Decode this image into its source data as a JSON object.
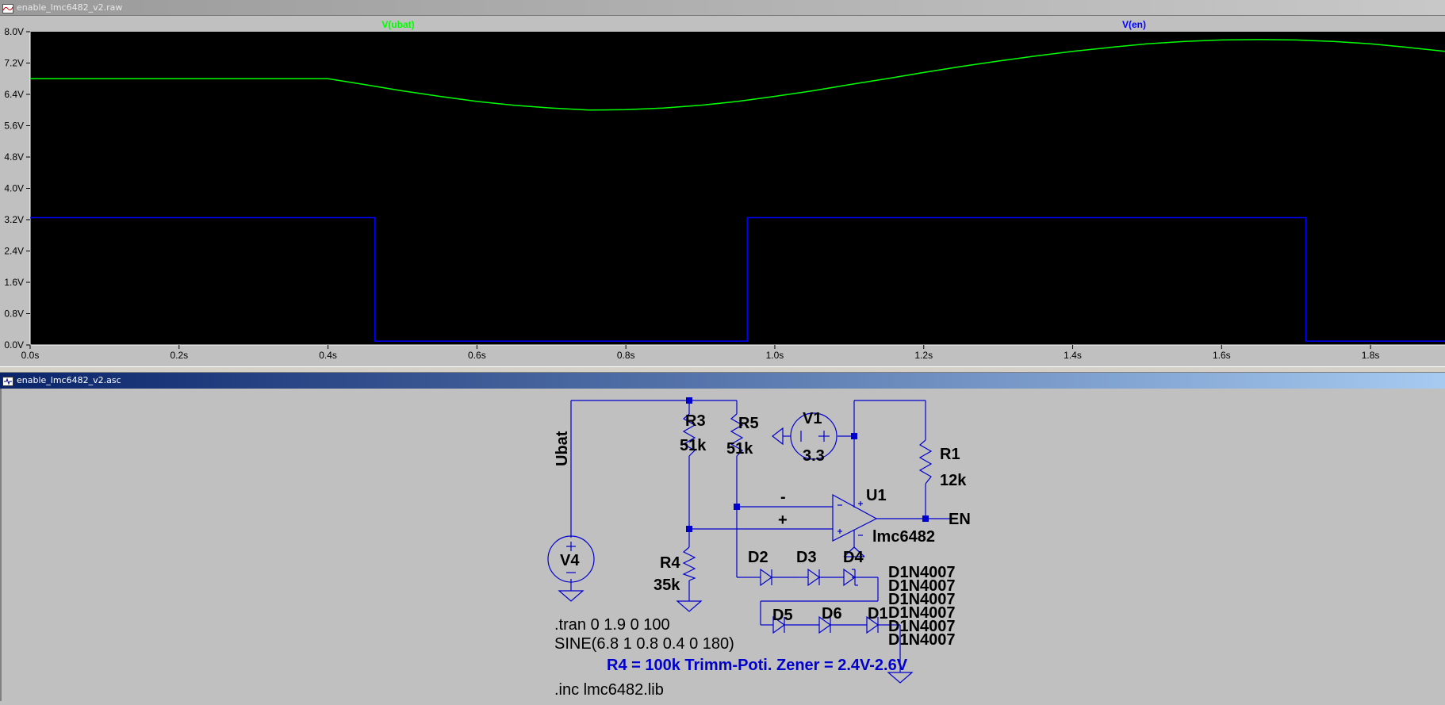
{
  "waveform_window": {
    "title": "enable_lmc6482_v2.raw",
    "traces": [
      {
        "name": "V(ubat)",
        "color": "#00ff00"
      },
      {
        "name": "V(en)",
        "color": "#0000ff"
      }
    ]
  },
  "schematic_window": {
    "title": "enable_lmc6482_v2.asc"
  },
  "chart_data": {
    "type": "line",
    "xlim": [
      0,
      1.9
    ],
    "ylim": [
      0,
      8
    ],
    "x_ticks": [
      "0.0s",
      "0.2s",
      "0.4s",
      "0.6s",
      "0.8s",
      "1.0s",
      "1.2s",
      "1.4s",
      "1.6s",
      "1.8s"
    ],
    "y_ticks": [
      "0.0V",
      "0.8V",
      "1.6V",
      "2.4V",
      "3.2V",
      "4.0V",
      "4.8V",
      "5.6V",
      "6.4V",
      "7.2V",
      "8.0V"
    ],
    "background": "#000000",
    "grid": false,
    "series": [
      {
        "name": "V(ubat)",
        "color": "#00ff00",
        "x": [
          0,
          0.1,
          0.2,
          0.3,
          0.4,
          0.45,
          0.5,
          0.55,
          0.6,
          0.65,
          0.7,
          0.75,
          0.8,
          0.85,
          0.9,
          0.95,
          1.0,
          1.05,
          1.1,
          1.15,
          1.2,
          1.25,
          1.3,
          1.35,
          1.4,
          1.45,
          1.5,
          1.55,
          1.6,
          1.65,
          1.7,
          1.75,
          1.8,
          1.85,
          1.9
        ],
        "values": [
          6.8,
          6.8,
          6.8,
          6.8,
          6.8,
          6.65,
          6.49,
          6.35,
          6.22,
          6.12,
          6.05,
          6.0,
          6.01,
          6.05,
          6.12,
          6.22,
          6.35,
          6.49,
          6.65,
          6.8,
          6.96,
          7.11,
          7.25,
          7.38,
          7.5,
          7.6,
          7.69,
          7.75,
          7.79,
          7.8,
          7.79,
          7.75,
          7.69,
          7.6,
          7.5
        ]
      },
      {
        "name": "V(en)",
        "color": "#0000ff",
        "x": [
          0,
          0.463,
          0.463,
          0.963,
          0.963,
          1.713,
          1.713,
          1.9
        ],
        "values": [
          3.25,
          3.25,
          0.1,
          0.1,
          3.25,
          3.25,
          0.1,
          0.1
        ]
      }
    ]
  },
  "schematic": {
    "labels": {
      "ubat": "Ubat",
      "r3_name": "R3",
      "r3_value": "51k",
      "r5_name": "R5",
      "r5_value": "51k",
      "v1_name": "V1",
      "v1_value": "3.3",
      "r1_name": "R1",
      "r1_value": "12k",
      "u1_name": "U1",
      "u1_model": "lmc6482",
      "en": "EN",
      "r4_name": "R4",
      "r4_value": "35k",
      "v4_name": "V4",
      "d2": "D2",
      "d3": "D3",
      "d4": "D4",
      "d5": "D5",
      "d6": "D6",
      "d1": "D1",
      "diode_models": [
        "D1N4007",
        "D1N4007",
        "D1N4007",
        "D1N4007",
        "D1N4007",
        "D1N4007"
      ],
      "opamp_minus": "-",
      "opamp_plus": "+"
    },
    "directives": {
      "tran": ".tran 0 1.9 0 100",
      "sine": "SINE(6.8 1 0.8 0.4 0 180)",
      "comment": "R4 = 100k Trimm-Poti. Zener = 2.4V-2.6V",
      "inc": ".inc lmc6482.lib"
    }
  }
}
